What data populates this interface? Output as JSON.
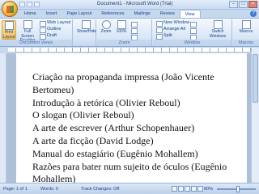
{
  "window": {
    "title": "Document1 - Microsoft Word (Trial)"
  },
  "tabs": [
    "Home",
    "Insert",
    "Page Layout",
    "References",
    "Mailings",
    "Review",
    "View"
  ],
  "ribbon": {
    "document_views": {
      "label": "Document Views",
      "print_layout": "Print Layout",
      "full_screen_reading": "Full Screen Reading",
      "web_layout": "Web Layout",
      "outline": "Outline",
      "draft": "Draft"
    },
    "show_hide": {
      "label": "Show/Hide"
    },
    "zoom": {
      "label": "Zoom",
      "zoom_button": "Zoom",
      "percent_button": "100%"
    },
    "window": {
      "label": "Window",
      "new_window": "New Window",
      "arrange_all": "Arrange All",
      "split": "Split",
      "switch_windows": "Switch Windows"
    },
    "macros": {
      "label": "Macros",
      "macros_button": "Macros"
    }
  },
  "document": {
    "lines": [
      "Criação na propaganda impressa (João Vicente Bertomeu)",
      "Introdução à retórica (Olivier Reboul)",
      "O slogan (Olivier Reboul)",
      "A arte de escrever (Arthur Schopenhauer)",
      "A arte da ficção (David Lodge)",
      "Manual do estagiário (Eugênio Mohallem)",
      "Razões para bater num sujeito de óculos (Eugênio Mohallem)"
    ]
  },
  "status": {
    "page": "Page: 1 of 1",
    "words": "Words: 0",
    "track_changes": "Track Changes: Off",
    "zoom": "80%"
  }
}
